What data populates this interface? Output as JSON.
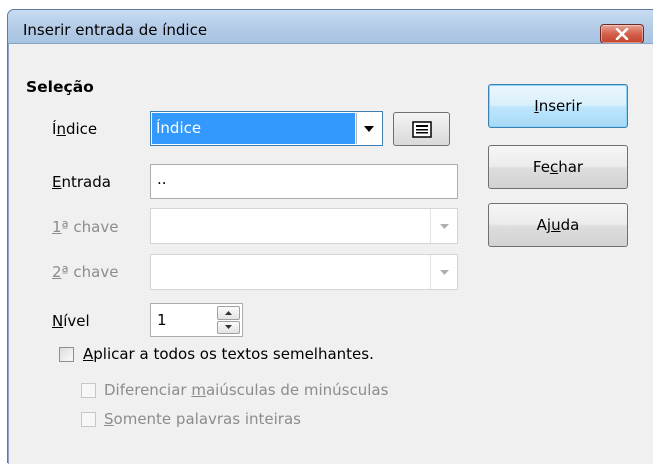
{
  "window": {
    "title": "Inserir entrada de índice"
  },
  "icons": {
    "close": "close-icon",
    "dropdown": "chevron-down-icon",
    "index_entry": "index-entry-icon",
    "spin_up": "spin-up-icon",
    "spin_down": "spin-down-icon"
  },
  "selection": {
    "heading": "Seleção",
    "index": {
      "label_pre": "Í",
      "label_key": "n",
      "label_post": "dice",
      "value": "Índice"
    },
    "entry": {
      "label_pre": "",
      "label_key": "E",
      "label_post": "ntrada",
      "value": ".."
    },
    "key1": {
      "label_pre": "",
      "label_key": "1",
      "label_post": "ª chave",
      "value": ""
    },
    "key2": {
      "label_pre": "",
      "label_key": "2",
      "label_post": "ª chave",
      "value": ""
    },
    "level": {
      "label_pre": "",
      "label_key": "N",
      "label_post": "ível",
      "value": "1"
    },
    "apply_all": {
      "label_pre": "",
      "label_key": "A",
      "label_post": "plicar a todos os textos semelhantes.",
      "checked": false
    },
    "match_case": {
      "label_pre": "Diferenciar ",
      "label_key": "m",
      "label_post": "aiúsculas de minúsculas",
      "checked": false,
      "enabled": false
    },
    "whole_words": {
      "label_pre": "",
      "label_key": "S",
      "label_post": "omente palavras inteiras",
      "checked": false,
      "enabled": false
    }
  },
  "buttons": {
    "insert": {
      "pre": "",
      "key": "I",
      "post": "nserir"
    },
    "close": {
      "pre": "Fe",
      "key": "c",
      "post": "har"
    },
    "help": {
      "pre": "Aj",
      "key": "u",
      "post": "da"
    }
  },
  "colors": {
    "title_bar": "#b6cde8",
    "close_button": "#c3432e",
    "selection_highlight": "#3399ff",
    "dialog_bg": "#f0f0f0"
  }
}
